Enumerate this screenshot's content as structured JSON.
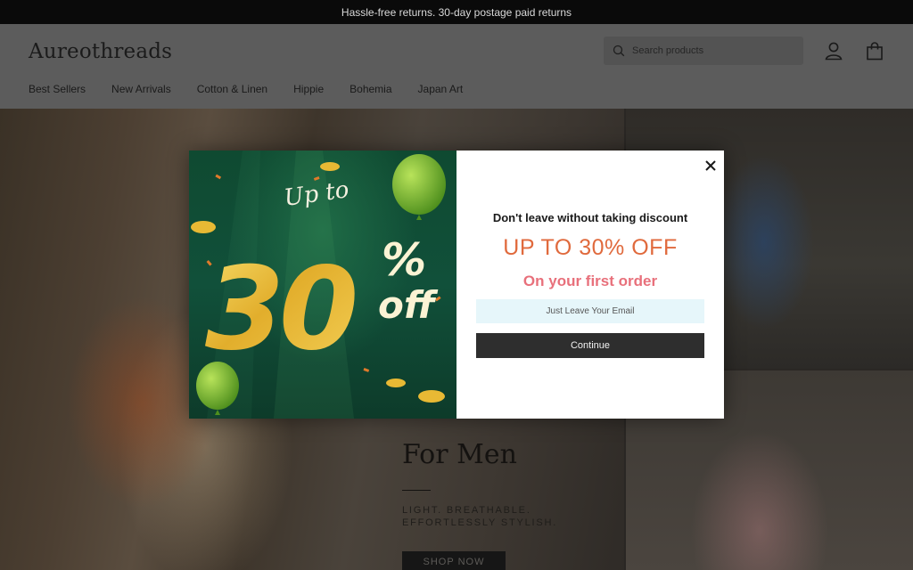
{
  "announcement": {
    "text": "Hassle-free returns. 30-day postage paid returns"
  },
  "header": {
    "logo": "Aureothreads",
    "search_placeholder": "Search products",
    "icons": [
      "search-icon",
      "account-icon",
      "cart-icon"
    ]
  },
  "nav": {
    "items": [
      "Best Sellers",
      "New Arrivals",
      "Cotton & Linen",
      "Hippie",
      "Bohemia",
      "Japan Art"
    ]
  },
  "hero": {
    "title": "For Men",
    "tagline_line1": "LIGHT. BREATHABLE.",
    "tagline_line2": "EFFORTLESSLY STYLISH.",
    "cta": "SHOP NOW"
  },
  "modal": {
    "promo": {
      "up_to": "Up to",
      "number": "30",
      "percent": "%",
      "off": "off"
    },
    "heading": "Don't leave without taking discount",
    "offer": "UP TO 30% OFF",
    "subheading": "On your first order",
    "email_placeholder": "Just Leave Your Email",
    "continue_label": "Continue",
    "close_icon": "close-icon"
  },
  "colors": {
    "offer": "#e06a3d",
    "subheading": "#e8707b",
    "email_bg": "#e6f6fa",
    "button_bg": "#2e2e2e",
    "promo_green": "#0f4a31",
    "gold": "#e8b934"
  }
}
